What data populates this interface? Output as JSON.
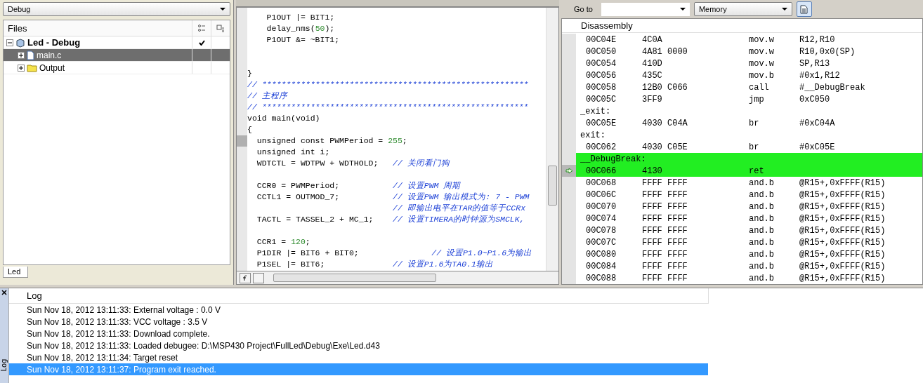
{
  "workspace": {
    "config": "Debug",
    "files_header": "Files",
    "tree": [
      {
        "label": "Led - Debug",
        "kind": "project",
        "expanded": true,
        "checked": true,
        "selected": false,
        "children": [
          {
            "label": "main.c",
            "kind": "file",
            "expanded": false,
            "checked": false,
            "selected": true
          },
          {
            "label": "Output",
            "kind": "folder",
            "expanded": false,
            "checked": false,
            "selected": false
          }
        ]
      }
    ],
    "bottom_tab": "Led"
  },
  "editor": {
    "lines": [
      {
        "kind": "code",
        "current": false,
        "segments": [
          {
            "t": "    P1OUT |= BIT1;",
            "kind": "plain"
          }
        ]
      },
      {
        "kind": "code",
        "current": false,
        "segments": [
          {
            "t": "    delay_nms(",
            "kind": "plain"
          },
          {
            "t": "50",
            "kind": "number"
          },
          {
            "t": ");",
            "kind": "plain"
          }
        ]
      },
      {
        "kind": "code",
        "current": false,
        "segments": [
          {
            "t": "    P1OUT &= ~BIT1;",
            "kind": "plain"
          }
        ]
      },
      {
        "kind": "blank",
        "current": false
      },
      {
        "kind": "blank",
        "current": false
      },
      {
        "kind": "code",
        "current": false,
        "segments": [
          {
            "t": "}",
            "kind": "plain"
          }
        ]
      },
      {
        "kind": "code",
        "current": false,
        "segments": [
          {
            "t": "// *******************************************************",
            "kind": "comment"
          }
        ]
      },
      {
        "kind": "code",
        "current": false,
        "segments": [
          {
            "t": "// 主程序",
            "kind": "comment"
          }
        ]
      },
      {
        "kind": "code",
        "current": false,
        "segments": [
          {
            "t": "// *******************************************************",
            "kind": "comment"
          }
        ]
      },
      {
        "kind": "code",
        "current": false,
        "segments": [
          {
            "t": "void main(void)",
            "kind": "plain"
          }
        ]
      },
      {
        "kind": "code",
        "current": false,
        "segments": [
          {
            "t": "{",
            "kind": "plain"
          }
        ]
      },
      {
        "kind": "code",
        "current": true,
        "segments": [
          {
            "t": "  unsigned const PWMPeriod = ",
            "kind": "plain"
          },
          {
            "t": "255",
            "kind": "number"
          },
          {
            "t": ";",
            "kind": "plain"
          }
        ]
      },
      {
        "kind": "code",
        "current": false,
        "segments": [
          {
            "t": "  unsigned int i;",
            "kind": "plain"
          }
        ]
      },
      {
        "kind": "code",
        "current": false,
        "segments": [
          {
            "t": "  WDTCTL = WDTPW + WDTHOLD;   ",
            "kind": "plain"
          },
          {
            "t": "// 关闭看门狗",
            "kind": "comment"
          }
        ]
      },
      {
        "kind": "blank",
        "current": false
      },
      {
        "kind": "code",
        "current": false,
        "segments": [
          {
            "t": "  CCR0 = PWMPeriod;           ",
            "kind": "plain"
          },
          {
            "t": "// 设置PWM 周期",
            "kind": "comment"
          }
        ]
      },
      {
        "kind": "code",
        "current": false,
        "segments": [
          {
            "t": "  CCTL1 = OUTMOD_7;           ",
            "kind": "plain"
          },
          {
            "t": "// 设置PWM 输出模式为: 7 - PWM",
            "kind": "comment"
          }
        ]
      },
      {
        "kind": "code",
        "current": false,
        "segments": [
          {
            "t": "                              // 即输出电平在TAR的值等于CCRx",
            "kind": "comment"
          }
        ]
      },
      {
        "kind": "code",
        "current": false,
        "segments": [
          {
            "t": "  TACTL = TASSEL_2 + MC_1;    ",
            "kind": "plain"
          },
          {
            "t": "// 设置TIMERA的时钟源为SMCLK,",
            "kind": "comment"
          }
        ]
      },
      {
        "kind": "blank",
        "current": false
      },
      {
        "kind": "code",
        "current": false,
        "segments": [
          {
            "t": "  CCR1 = ",
            "kind": "plain"
          },
          {
            "t": "120",
            "kind": "number"
          },
          {
            "t": ";",
            "kind": "plain"
          }
        ]
      },
      {
        "kind": "code",
        "current": false,
        "segments": [
          {
            "t": "  P1DIR |= BIT6 + BIT0;               ",
            "kind": "plain"
          },
          {
            "t": "// 设置P1.0~P1.6为输出",
            "kind": "comment"
          }
        ]
      },
      {
        "kind": "code",
        "current": false,
        "segments": [
          {
            "t": "  P1SEL |= BIT6;              ",
            "kind": "plain"
          },
          {
            "t": "// 设置P1.6为TA0.1输出",
            "kind": "comment"
          }
        ]
      }
    ]
  },
  "disassembly": {
    "goto_label": "Go to",
    "memory": "Memory",
    "title": "Disassembly",
    "rows": [
      {
        "kind": "instr",
        "addr": "00C04E",
        "bytes": "4C0A",
        "op": "mov.w",
        "args": "R12,R10",
        "highlighted": false,
        "current": false
      },
      {
        "kind": "instr",
        "addr": "00C050",
        "bytes": "4A81 0000",
        "op": "mov.w",
        "args": "R10,0x0(SP)",
        "highlighted": false,
        "current": false
      },
      {
        "kind": "instr",
        "addr": "00C054",
        "bytes": "410D",
        "op": "mov.w",
        "args": "SP,R13",
        "highlighted": false,
        "current": false
      },
      {
        "kind": "instr",
        "addr": "00C056",
        "bytes": "435C",
        "op": "mov.b",
        "args": "#0x1,R12",
        "highlighted": false,
        "current": false
      },
      {
        "kind": "instr",
        "addr": "00C058",
        "bytes": "12B0 C066",
        "op": "call",
        "args": "#__DebugBreak",
        "highlighted": false,
        "current": false
      },
      {
        "kind": "instr",
        "addr": "00C05C",
        "bytes": "3FF9",
        "op": "jmp",
        "args": "0xC050",
        "highlighted": false,
        "current": false
      },
      {
        "kind": "label",
        "text": "_exit:",
        "highlighted": false,
        "current": false
      },
      {
        "kind": "instr",
        "addr": "00C05E",
        "bytes": "4030 C04A",
        "op": "br",
        "args": "#0xC04A",
        "highlighted": false,
        "current": false
      },
      {
        "kind": "label",
        "text": "exit:",
        "highlighted": false,
        "current": false
      },
      {
        "kind": "instr",
        "addr": "00C062",
        "bytes": "4030 C05E",
        "op": "br",
        "args": "#0xC05E",
        "highlighted": false,
        "current": false
      },
      {
        "kind": "label",
        "text": "__DebugBreak:",
        "highlighted": true,
        "current": false
      },
      {
        "kind": "instr",
        "addr": "00C066",
        "bytes": "4130",
        "op": "ret",
        "highlighted": true,
        "current": true
      },
      {
        "kind": "instr",
        "addr": "00C068",
        "bytes": "FFFF FFFF",
        "op": "and.b",
        "args": "@R15+,0xFFFF(R15)",
        "highlighted": false,
        "current": false
      },
      {
        "kind": "instr",
        "addr": "00C06C",
        "bytes": "FFFF FFFF",
        "op": "and.b",
        "args": "@R15+,0xFFFF(R15)",
        "highlighted": false,
        "current": false
      },
      {
        "kind": "instr",
        "addr": "00C070",
        "bytes": "FFFF FFFF",
        "op": "and.b",
        "args": "@R15+,0xFFFF(R15)",
        "highlighted": false,
        "current": false
      },
      {
        "kind": "instr",
        "addr": "00C074",
        "bytes": "FFFF FFFF",
        "op": "and.b",
        "args": "@R15+,0xFFFF(R15)",
        "highlighted": false,
        "current": false
      },
      {
        "kind": "instr",
        "addr": "00C078",
        "bytes": "FFFF FFFF",
        "op": "and.b",
        "args": "@R15+,0xFFFF(R15)",
        "highlighted": false,
        "current": false
      },
      {
        "kind": "instr",
        "addr": "00C07C",
        "bytes": "FFFF FFFF",
        "op": "and.b",
        "args": "@R15+,0xFFFF(R15)",
        "highlighted": false,
        "current": false
      },
      {
        "kind": "instr",
        "addr": "00C080",
        "bytes": "FFFF FFFF",
        "op": "and.b",
        "args": "@R15+,0xFFFF(R15)",
        "highlighted": false,
        "current": false
      },
      {
        "kind": "instr",
        "addr": "00C084",
        "bytes": "FFFF FFFF",
        "op": "and.b",
        "args": "@R15+,0xFFFF(R15)",
        "highlighted": false,
        "current": false
      },
      {
        "kind": "instr",
        "addr": "00C088",
        "bytes": "FFFF FFFF",
        "op": "and.b",
        "args": "@R15+,0xFFFF(R15)",
        "highlighted": false,
        "current": false
      }
    ]
  },
  "log": {
    "side_tab": "Log",
    "title": "Log",
    "rows": [
      {
        "text": "Sun Nov 18, 2012 13:11:33: External voltage : 0.0 V",
        "selected": false
      },
      {
        "text": "Sun Nov 18, 2012 13:11:33: VCC voltage : 3.5 V",
        "selected": false
      },
      {
        "text": "Sun Nov 18, 2012 13:11:33: Download complete.",
        "selected": false
      },
      {
        "text": "Sun Nov 18, 2012 13:11:33: Loaded debugee: D:\\MSP430 Project\\FullLed\\Debug\\Exe\\Led.d43",
        "selected": false
      },
      {
        "text": "Sun Nov 18, 2012 13:11:34: Target reset",
        "selected": false
      },
      {
        "text": "Sun Nov 18, 2012 13:11:37: Program exit reached.",
        "selected": true
      }
    ]
  }
}
